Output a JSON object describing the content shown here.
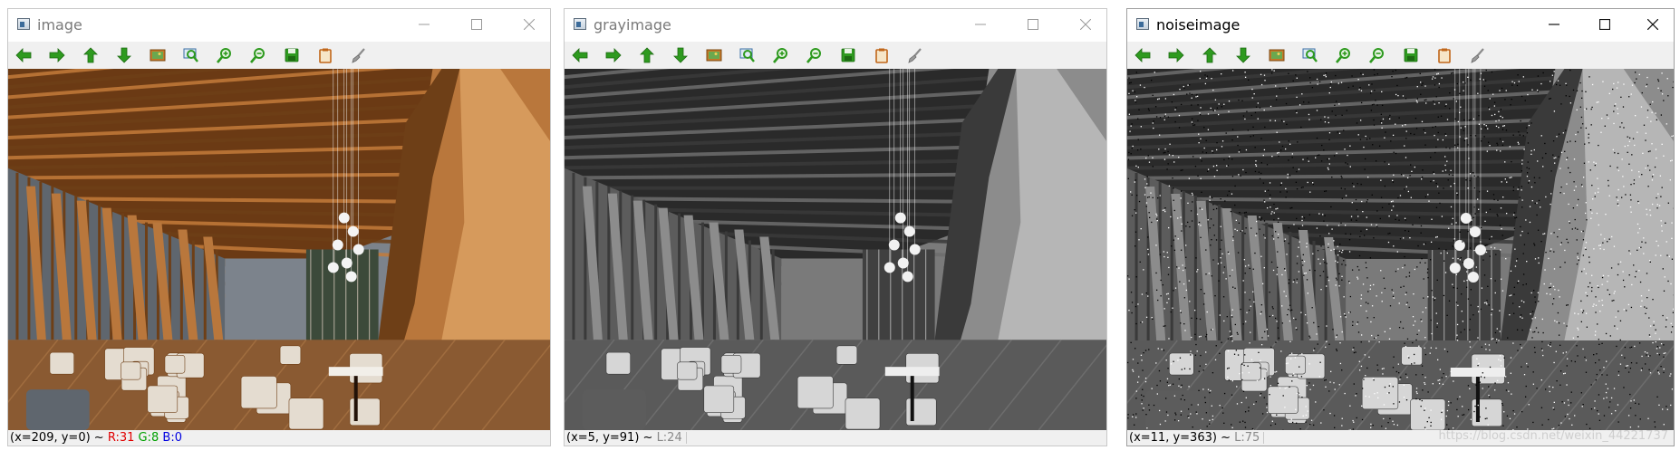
{
  "windows": [
    {
      "title": "image",
      "status": {
        "coords": "(x=209, y=0) ~ ",
        "r": "R:31",
        "g": "G:8",
        "b": "B:0"
      },
      "tone": "color"
    },
    {
      "title": "grayimage",
      "status": {
        "coords": "(x=5, y=91) ~ ",
        "l": "L:24"
      },
      "tone": "gray"
    },
    {
      "title": "noiseimage",
      "status": {
        "coords": "(x=11, y=363) ~ ",
        "l": "L:75"
      },
      "tone": "noise"
    }
  ],
  "toolbar_icons": [
    "arrow-left-icon",
    "arrow-right-icon",
    "arrow-up-icon",
    "arrow-down-icon",
    "picture-icon",
    "zoom-region-icon",
    "zoom-in-icon",
    "zoom-out-icon",
    "save-icon",
    "clipboard-icon",
    "brush-icon"
  ],
  "watermark": "https://blog.csdn.net/weixin_44221737",
  "colors": {
    "toolbar_green": "#2e9a1f",
    "toolbar_bg": "#f0f0f0",
    "status_r": "#e00000",
    "status_g": "#00a000",
    "status_b": "#0000e0"
  }
}
